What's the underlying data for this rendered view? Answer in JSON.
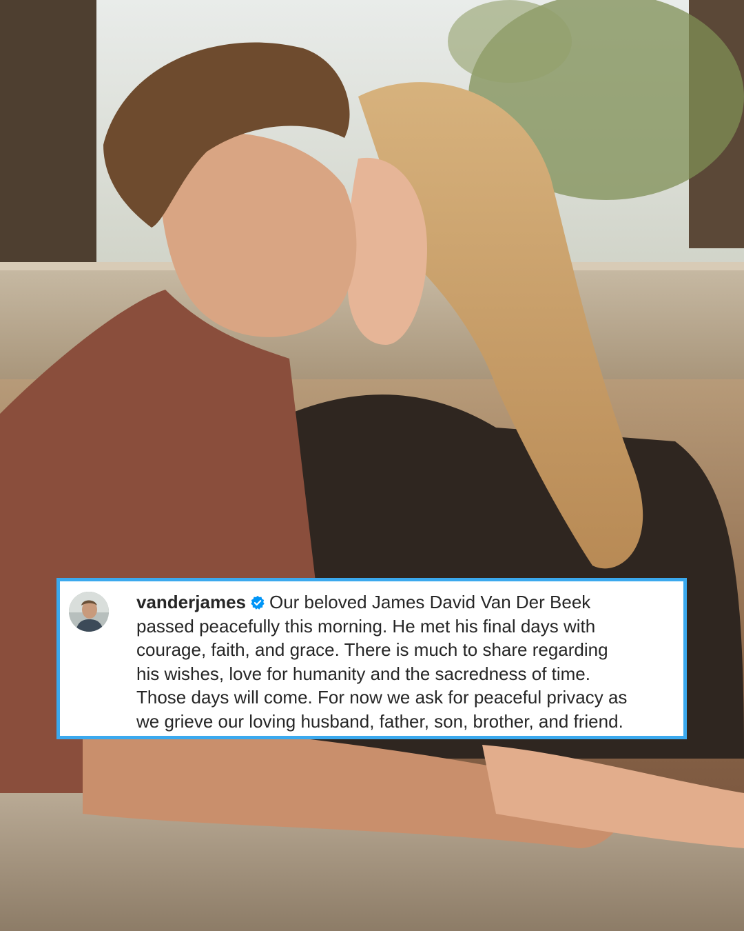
{
  "post": {
    "photo": {
      "description_icon": "couple-photo"
    },
    "caption": {
      "username": "vanderjames",
      "verified": true,
      "verified_icon": "verified-badge-icon",
      "avatar_icon": "profile-avatar-icon",
      "first_line_rest": "Our beloved James David Van Der Beek",
      "lines": [
        "passed peacefully this morning. He met his final days with",
        "courage, faith, and grace. There is much to share regarding",
        "his wishes, love for humanity and the sacredness of time.",
        "Those days will come. For now we ask for peaceful privacy as",
        "we grieve our loving husband, father, son, brother, and friend."
      ]
    },
    "colors": {
      "card_border": "#3ba9ee",
      "card_background": "#ffffff",
      "text": "#262626",
      "verified_badge": "#0095f6"
    }
  }
}
